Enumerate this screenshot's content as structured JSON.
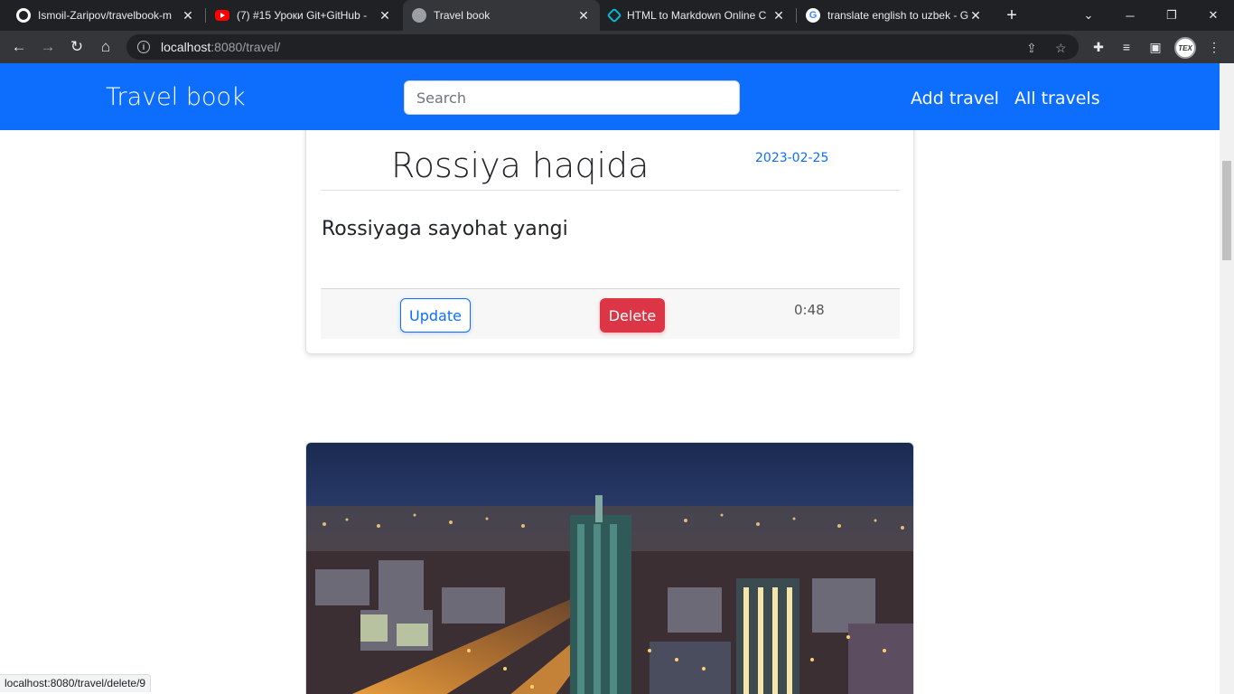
{
  "browser": {
    "tabs": [
      {
        "title": "Ismoil-Zaripov/travelbook-m",
        "favicon": "github-icon"
      },
      {
        "title": "(7) #15 Уроки Git+GitHub - ",
        "favicon": "youtube-icon"
      },
      {
        "title": "Travel book",
        "favicon": "globe-icon",
        "active": true
      },
      {
        "title": "HTML to Markdown Online C",
        "favicon": "markdown-icon"
      },
      {
        "title": "translate english to uzbek - G",
        "favicon": "google-icon"
      }
    ],
    "new_tab": "+",
    "address": {
      "host": "localhost",
      "path": ":8080/travel/"
    },
    "profile_badge": "TEX"
  },
  "navbar": {
    "brand": "Travel book",
    "search_placeholder": "Search",
    "links": [
      "Add travel",
      "All travels"
    ],
    "color": "#0d6efd"
  },
  "card": {
    "title": "Rossiya haqida",
    "date": "2023-02-25",
    "text": "Rossiyaga sayohat yangi",
    "update_label": "Update",
    "delete_label": "Delete",
    "time": "0:48"
  },
  "photo": {
    "subject": "night city skyline"
  },
  "status_url": "localhost:8080/travel/delete/9",
  "colors": {
    "primary": "#0d6efd",
    "danger": "#dc3545"
  }
}
